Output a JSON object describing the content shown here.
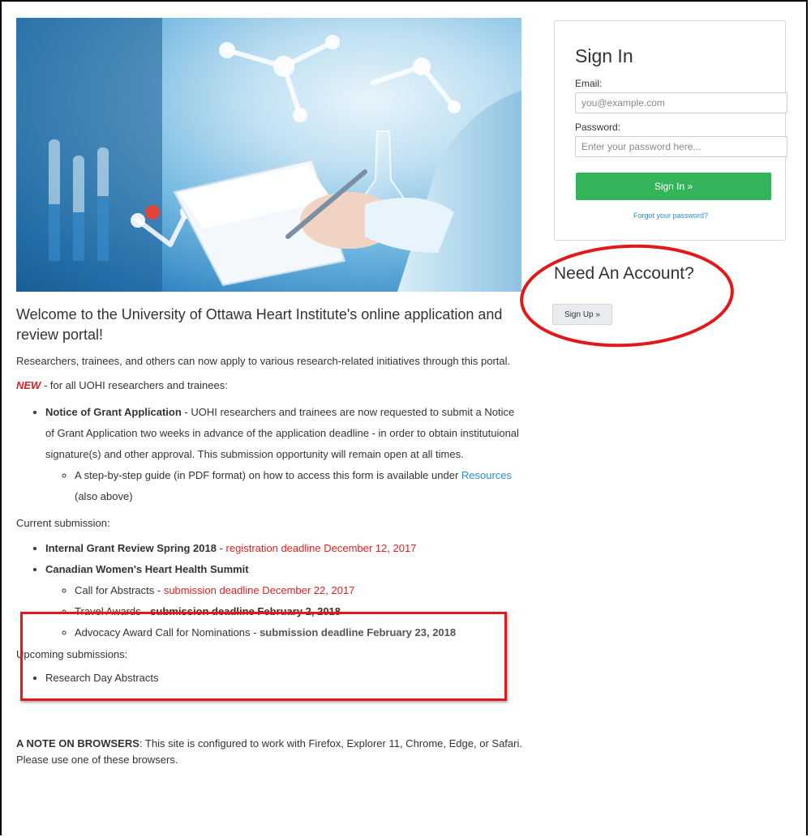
{
  "main": {
    "welcome": "Welcome to the University of Ottawa Heart Institute's online application and review portal!",
    "intro": "Researchers, trainees, and others can now apply to various research-related initiatives through this portal.",
    "new_label": "NEW",
    "new_text": " - for all UOHI researchers and trainees:",
    "notice": {
      "title": "Notice of Grant Application",
      "text": " - UOHI researchers and trainees are now requested to submit a Notice of Grant Application two weeks in advance of the application deadline - in order to obtain institutuional signature(s) and other approval. This submission opportunity will remain open at all times.",
      "guide_pre": "A step-by-step guide (in PDF format) on how to access this form is available under ",
      "guide_link": "Resources",
      "guide_post": " (also above)"
    },
    "current_label": "Current submission:",
    "current": {
      "internal_title": "Internal Grant Review Spring 2018",
      "internal_sep": " - ",
      "internal_deadline": "registration deadline December 12, 2017",
      "summit_title": "Canadian Women's Heart Health Summit",
      "abstracts_label": "Call for Abstracts - ",
      "abstracts_deadline": "submission deadline December 22, 2017",
      "travel_label": "Travel Awards - ",
      "travel_deadline": "submission deadline February 2, 2018",
      "advocacy_label": "Advocacy Award Call for Nominations  - ",
      "advocacy_deadline": "submission deadline February 23, 2018"
    },
    "upcoming_label": "Upcoming submissions:",
    "upcoming_item": "Research Day Abstracts",
    "browser_label": "A NOTE ON BROWSERS",
    "browser_text": ": This site is configured to work with Firefox, Explorer 11, Chrome, Edge, or Safari. Please use one of these browsers."
  },
  "signin": {
    "title": "Sign In",
    "email_label": "Email:",
    "email_placeholder": "you@example.com",
    "password_label": "Password:",
    "password_placeholder": "Enter your password here...",
    "button": "Sign In »",
    "forgot": "Forgot your password?"
  },
  "account": {
    "title": "Need An Account?",
    "signup_button": "Sign Up »"
  },
  "colors": {
    "accent_green": "#33b35a",
    "link_blue": "#2d8ec9",
    "deadline_red": "#e02020",
    "annotation_red": "#e01a1a"
  }
}
